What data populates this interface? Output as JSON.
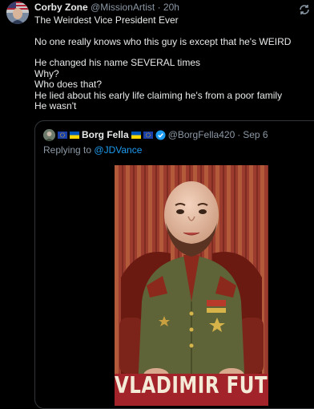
{
  "tweet": {
    "author_name": "Corby Zone",
    "author_handle": "@MissionArtist",
    "separator": "·",
    "time": "20h",
    "lines": [
      "The Weirdest Vice President Ever",
      "",
      "No one really knows who this guy is except that he's WEIRD",
      "",
      "He changed his name SEVERAL times",
      "Why?",
      "Who does that?",
      "He lied about his early life claiming he's from a poor family",
      "He wasn't"
    ]
  },
  "quoted_tweet": {
    "author_name": "Borg Fella",
    "author_handle": "@BorgFella420",
    "separator": "·",
    "date": "Sep 6",
    "replying_prefix": "Replying to",
    "replying_to": "@JDVance",
    "image_caption": "VLADIMIR FUTON"
  },
  "icons": [
    "avatar",
    "us-flag",
    "sync-icon",
    "eu-flag-icon",
    "ukraine-flag-icon",
    "verified-icon"
  ],
  "colors": {
    "background": "#000000",
    "text": "#e7e9ea",
    "muted": "#8b98a5",
    "link": "#1d9bf0",
    "caption_band": "#a3232a"
  }
}
